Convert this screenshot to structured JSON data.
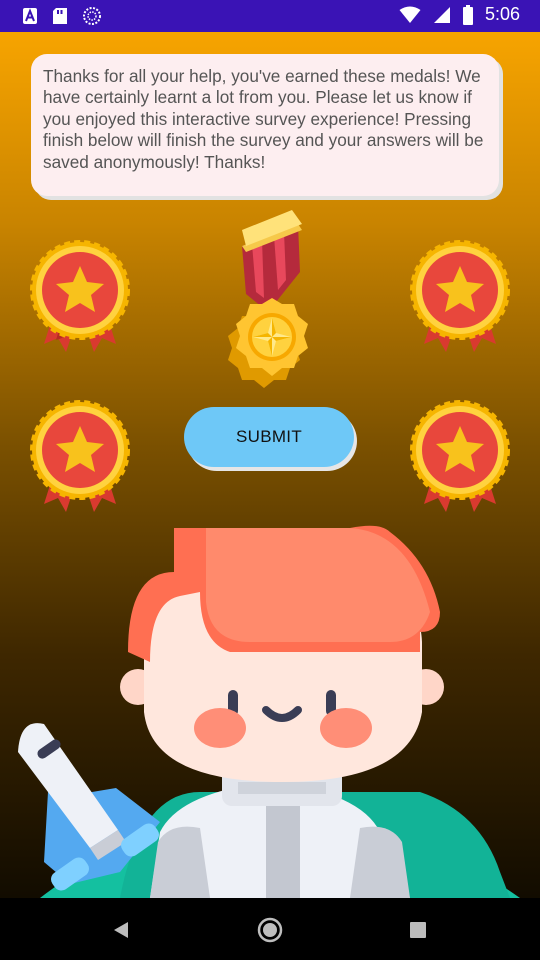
{
  "status_bar": {
    "time": "5:06",
    "left_icons": [
      "a-icon",
      "sd-card-icon",
      "sync-icon"
    ],
    "right_icons": [
      "wifi-icon",
      "signal-icon",
      "battery-icon"
    ],
    "background": "#3a13b5"
  },
  "message": {
    "text": "Thanks for all your help, you've earned these medals! We have certainly learnt a lot from you. Please let us know if you enjoyed this interactive survey experience! Pressing finish below will finish the survey and your answers will be saved anonymously! Thanks!"
  },
  "submit_button": {
    "label": "SUBMIT",
    "color": "#6ec8f7"
  },
  "badges": [
    "star-badge-icon",
    "star-badge-icon",
    "star-badge-icon",
    "star-badge-icon"
  ],
  "gold_medal_icon": "gold-medal-icon",
  "illustration": {
    "icon": "astronaut-boy-illustration",
    "rocket": "rocket-icon"
  },
  "nav_bar": {
    "buttons": [
      "back-icon",
      "home-icon",
      "recents-icon"
    ]
  }
}
